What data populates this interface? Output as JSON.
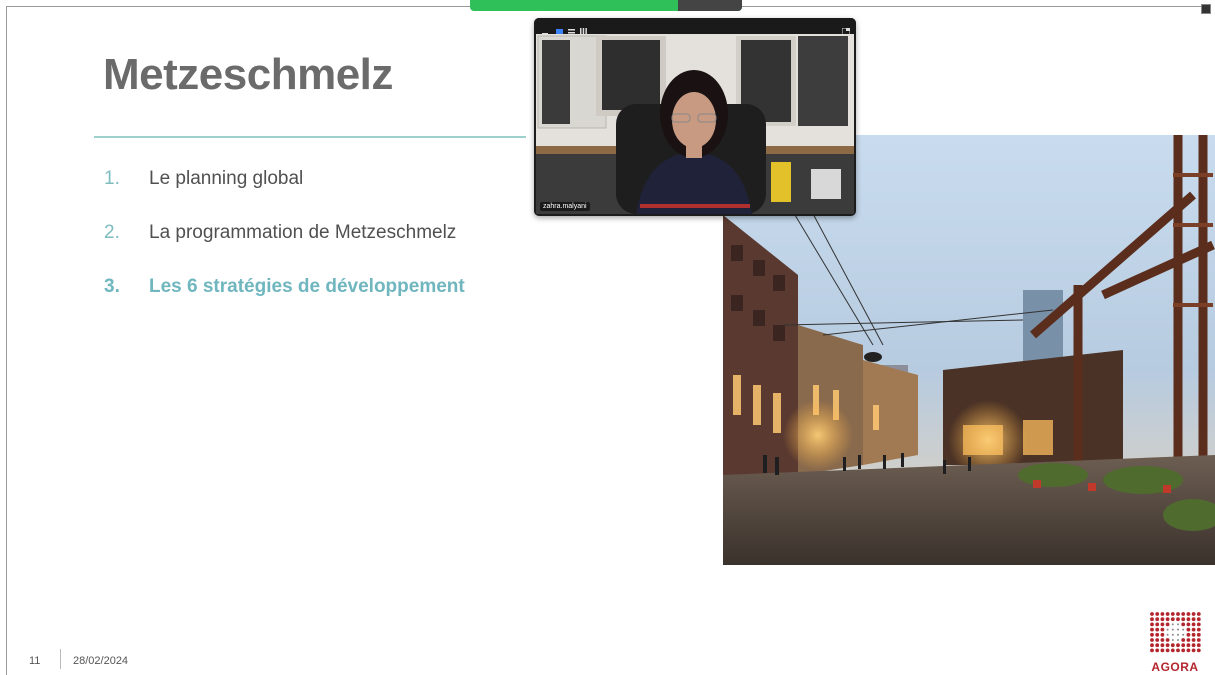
{
  "slide": {
    "title": "Metzeschmelz",
    "agenda": [
      {
        "num": "1.",
        "label": "Le planning global",
        "active": false
      },
      {
        "num": "2.",
        "label": "La programmation de Metzeschmelz",
        "active": false
      },
      {
        "num": "3.",
        "label": "Les 6 stratégies de développement",
        "active": true
      }
    ],
    "page_number": "11",
    "date": "28/02/2024",
    "logo_text": "AGORA"
  },
  "video": {
    "participant_name": "zahra.malyani"
  },
  "colors": {
    "title": "#6b6b6b",
    "accent_teal": "#6fb6bf",
    "rule": "#9fd1cc",
    "logo_red": "#b3262d",
    "share_bar": "#2fc05a"
  },
  "icons": [
    "minimize-icon",
    "tile-view-icon",
    "speaker-view-icon",
    "gallery-grid-icon",
    "expand-icon"
  ]
}
